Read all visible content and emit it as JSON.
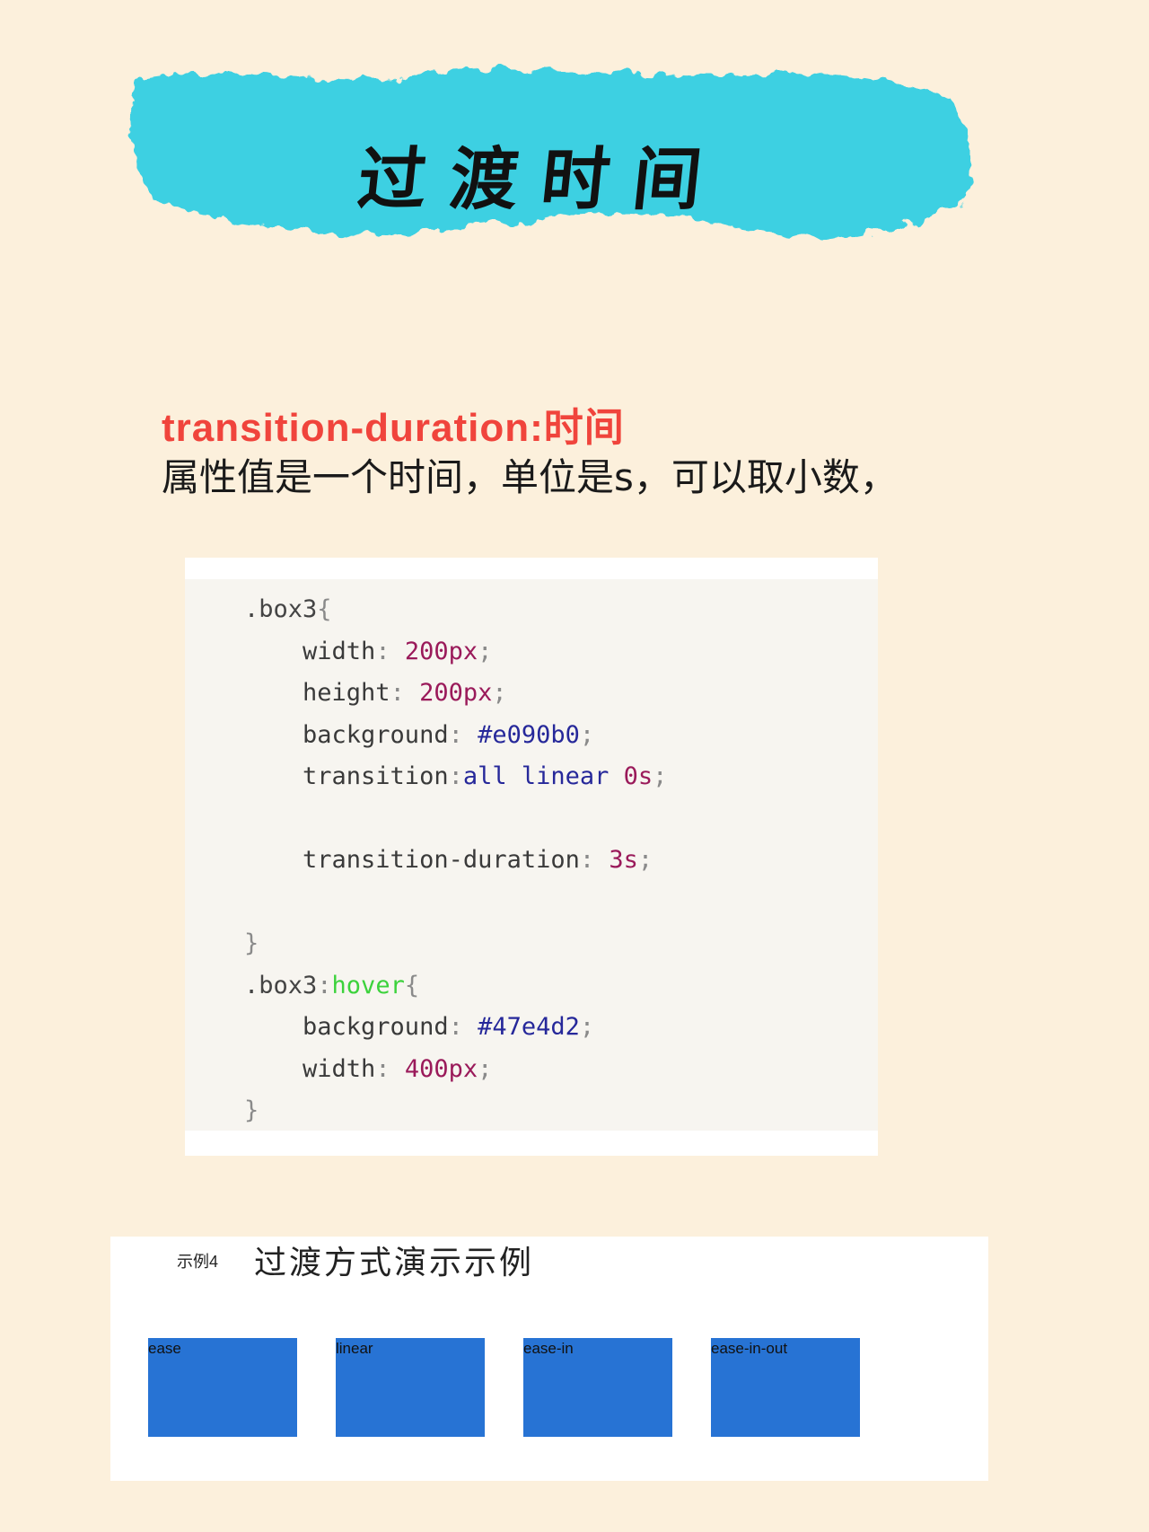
{
  "banner": {
    "title": "过渡时间",
    "brush_color": "#3ed0e2"
  },
  "intro": {
    "heading": "transition-duration:时间",
    "description": "属性值是一个时间，单位是s，可以取小数，",
    "heading_color": "#f0443c"
  },
  "code": {
    "lines": [
      [
        {
          "t": ".box3",
          "c": "sel"
        },
        {
          "t": "{",
          "c": "punc"
        }
      ],
      [
        {
          "t": "    width",
          "c": "prop"
        },
        {
          "t": ": ",
          "c": "punc"
        },
        {
          "t": "200px",
          "c": "num"
        },
        {
          "t": ";",
          "c": "punc"
        }
      ],
      [
        {
          "t": "    height",
          "c": "prop"
        },
        {
          "t": ": ",
          "c": "punc"
        },
        {
          "t": "200px",
          "c": "num"
        },
        {
          "t": ";",
          "c": "punc"
        }
      ],
      [
        {
          "t": "    background",
          "c": "prop"
        },
        {
          "t": ": ",
          "c": "punc"
        },
        {
          "t": "#e090b0",
          "c": "kw"
        },
        {
          "t": ";",
          "c": "punc"
        }
      ],
      [
        {
          "t": "    transition",
          "c": "prop"
        },
        {
          "t": ":",
          "c": "punc"
        },
        {
          "t": "all linear ",
          "c": "kw"
        },
        {
          "t": "0s",
          "c": "num"
        },
        {
          "t": ";",
          "c": "punc"
        }
      ],
      [],
      [
        {
          "t": "    transition-duration",
          "c": "prop"
        },
        {
          "t": ": ",
          "c": "punc"
        },
        {
          "t": "3s",
          "c": "num"
        },
        {
          "t": ";",
          "c": "punc"
        }
      ],
      [],
      [
        {
          "t": "}",
          "c": "punc"
        }
      ],
      [
        {
          "t": ".box3",
          "c": "sel"
        },
        {
          "t": ":",
          "c": "punc"
        },
        {
          "t": "hover",
          "c": "pseudo"
        },
        {
          "t": "{",
          "c": "punc"
        }
      ],
      [
        {
          "t": "    background",
          "c": "prop"
        },
        {
          "t": ": ",
          "c": "punc"
        },
        {
          "t": "#47e4d2",
          "c": "kw"
        },
        {
          "t": ";",
          "c": "punc"
        }
      ],
      [
        {
          "t": "    width",
          "c": "prop"
        },
        {
          "t": ": ",
          "c": "punc"
        },
        {
          "t": "400px",
          "c": "num"
        },
        {
          "t": ";",
          "c": "punc"
        }
      ],
      [
        {
          "t": "}",
          "c": "punc"
        }
      ]
    ]
  },
  "demo": {
    "label": "示例4",
    "title": "过渡方式演示示例",
    "box_color": "#2773d4",
    "boxes": [
      "ease",
      "linear",
      "ease-in",
      "ease-in-out"
    ]
  }
}
